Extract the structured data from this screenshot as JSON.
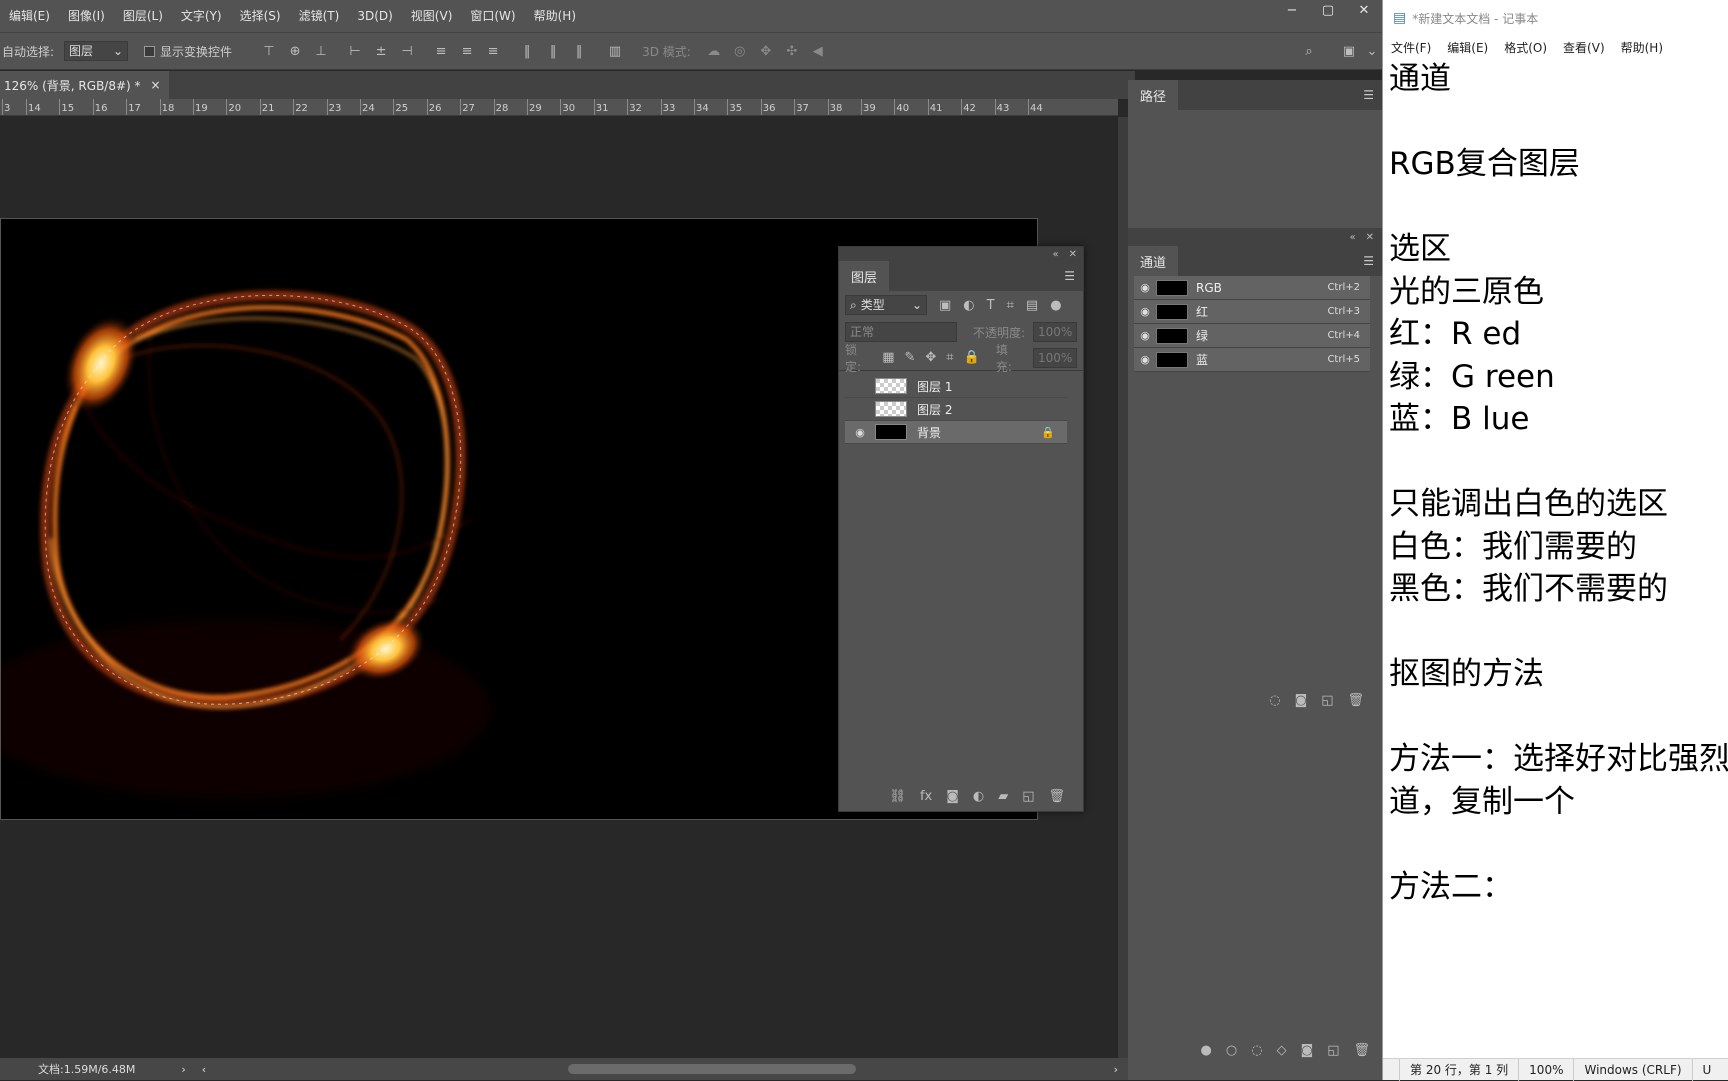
{
  "ps": {
    "menus": [
      "编辑(E)",
      "图像(I)",
      "图层(L)",
      "文字(Y)",
      "选择(S)",
      "滤镜(T)",
      "3D(D)",
      "视图(V)",
      "窗口(W)",
      "帮助(H)"
    ],
    "window_controls": [
      "−",
      "▢",
      "✕"
    ],
    "options": {
      "auto_select_label": "自动选择:",
      "auto_select_value": "图层",
      "show_transform_label": "显示变换控件",
      "mode3d_label": "3D 模式:"
    },
    "doc_tab": {
      "title": "126% (背景, RGB/8#) *",
      "close": "×"
    },
    "ruler_ticks": [
      "3",
      "14",
      "15",
      "16",
      "17",
      "18",
      "19",
      "20",
      "21",
      "22",
      "23",
      "24",
      "25",
      "26",
      "27",
      "28",
      "29",
      "30",
      "31",
      "32",
      "33",
      "34",
      "35",
      "36",
      "37",
      "38",
      "39",
      "40",
      "41",
      "42",
      "43",
      "44"
    ],
    "status": {
      "doc_info": "文档:1.59M/6.48M",
      "arrow": "›",
      "scroll_left": "‹",
      "scroll_right": "›"
    }
  },
  "paths_panel": {
    "tab": "路径"
  },
  "channels_panel": {
    "tab": "通道",
    "rows": [
      {
        "name": "RGB",
        "shortcut": "Ctrl+2"
      },
      {
        "name": "红",
        "shortcut": "Ctrl+3"
      },
      {
        "name": "绿",
        "shortcut": "Ctrl+4"
      },
      {
        "name": "蓝",
        "shortcut": "Ctrl+5"
      }
    ]
  },
  "layers_panel": {
    "tab": "图层",
    "filter_value": "类型",
    "blend_mode": "正常",
    "opacity_label": "不透明度:",
    "opacity_value": "100%",
    "lock_label": "锁定:",
    "fill_label": "填充:",
    "fill_value": "100%",
    "layers": [
      {
        "name": "图层 1",
        "visible": false
      },
      {
        "name": "图层 2",
        "visible": false
      },
      {
        "name": "背景",
        "visible": true,
        "locked": true
      }
    ]
  },
  "notepad": {
    "title": "*新建文本文档 - 记事本",
    "menus": [
      "文件(F)",
      "编辑(E)",
      "格式(O)",
      "查看(V)",
      "帮助(H)"
    ],
    "text": "通道\n\nRGB复合图层\n\n选区\n光的三原色\n红：R ed\n绿：G reen\n蓝：B lue\n\n只能调出白色的选区\n白色：我们需要的\n黑色：我们不需要的\n\n抠图的方法\n\n方法一：选择好对比强烈的通\n道，复制一个\n\n方法二：",
    "status": {
      "position": "第 20 行，第 1 列",
      "zoom": "100%",
      "eol": "Windows (CRLF)",
      "enc": "U"
    }
  },
  "colors": {
    "ps_panel": "#535353",
    "ps_bg": "#282828",
    "notepad_bg": "#ffffff",
    "glow": "#ff8a1a"
  }
}
